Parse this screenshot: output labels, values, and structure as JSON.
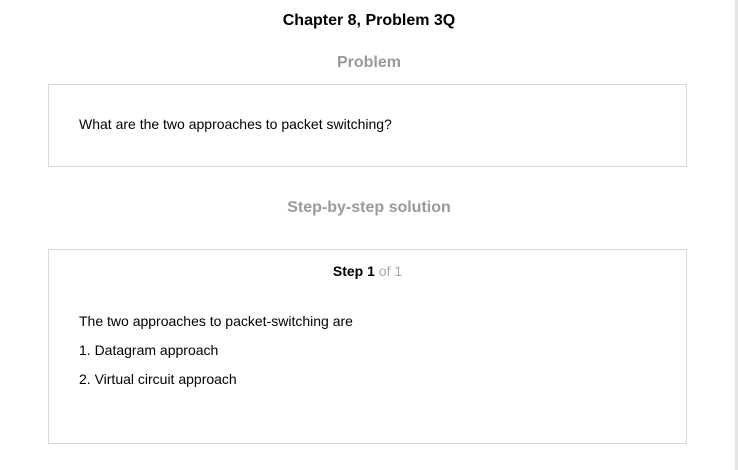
{
  "header": {
    "title": "Chapter 8, Problem 3Q"
  },
  "problem": {
    "heading": "Problem",
    "text": "What are the two approaches to packet switching?"
  },
  "solution": {
    "heading": "Step-by-step solution",
    "step": {
      "label": "Step",
      "number": "1",
      "total_text": "of 1"
    },
    "intro": "The two approaches to packet-switching are",
    "items": [
      "1. Datagram approach",
      "2. Virtual circuit approach"
    ]
  }
}
